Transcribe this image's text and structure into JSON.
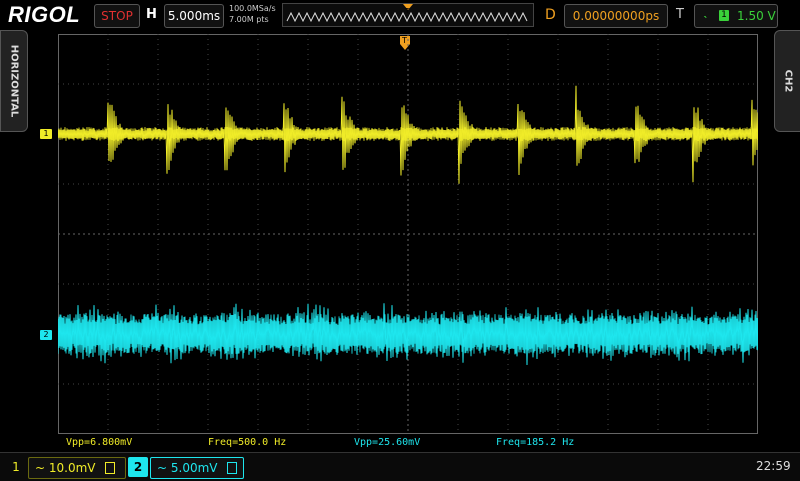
{
  "brand": "RIGOL",
  "run_state": "STOP",
  "horizontal": {
    "label": "H",
    "timebase": "5.000ms",
    "sample_rate": "100.0MSa/s",
    "memory_depth": "7.00M pts"
  },
  "delay": {
    "label": "D",
    "value": "0.00000000ps"
  },
  "trigger": {
    "label": "T",
    "edge_icon": "rising-edge-icon",
    "source": "1",
    "level": "1.50 V"
  },
  "side_tabs": {
    "left": "HORIZONTAL",
    "right": "CH2"
  },
  "trigger_marker": "T",
  "channels": [
    {
      "id": "1",
      "color": "#f0ec28",
      "coupling": "~",
      "scale": "10.0mV"
    },
    {
      "id": "2",
      "color": "#1ee6ee",
      "coupling": "~",
      "scale": "5.00mV"
    }
  ],
  "measurements": [
    {
      "text": "Vpp=6.800mV",
      "color": "#f0ec28"
    },
    {
      "text": "Freq=500.0 Hz",
      "color": "#f0ec28"
    },
    {
      "text": "Vpp=25.60mV",
      "color": "#1ee6ee"
    },
    {
      "text": "Freq=185.2 Hz",
      "color": "#1ee6ee"
    }
  ],
  "clock": "22:59"
}
